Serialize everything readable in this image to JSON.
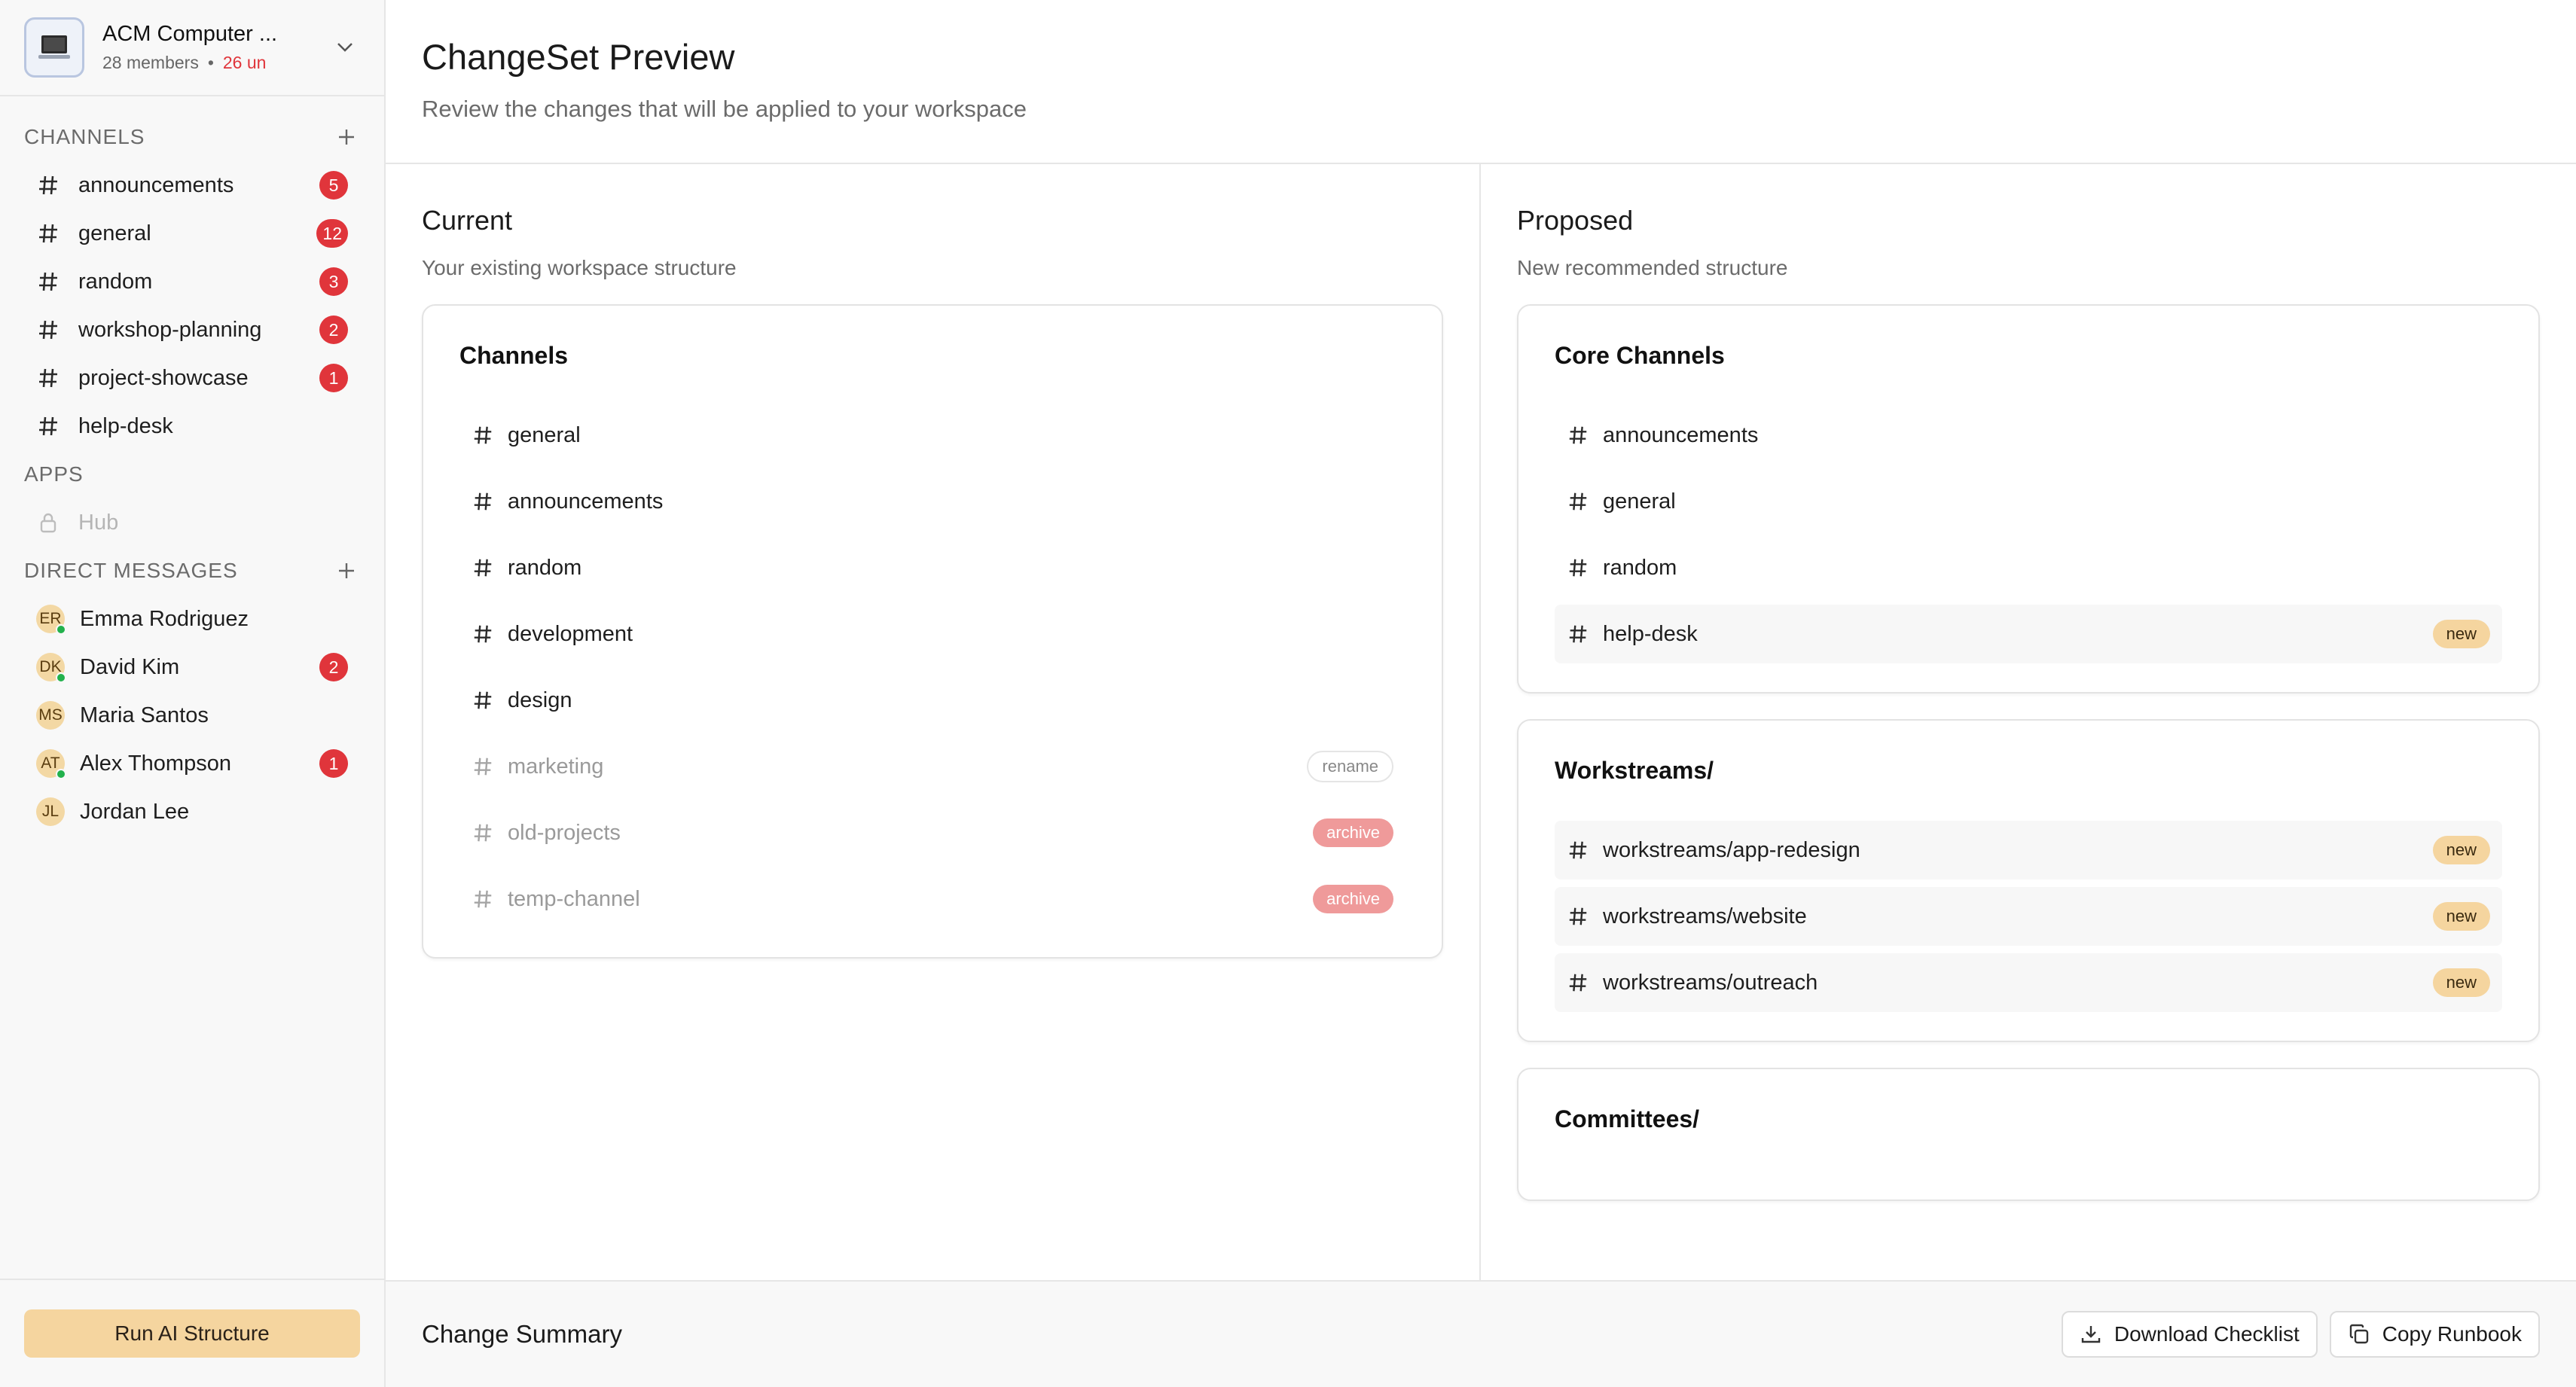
{
  "workspace": {
    "name": "ACM Computer ...",
    "members": "28 members",
    "separator": "•",
    "unread": "26 un"
  },
  "sidebar": {
    "channels_heading": "CHANNELS",
    "channels": [
      {
        "label": "announcements",
        "badge": "5"
      },
      {
        "label": "general",
        "badge": "12"
      },
      {
        "label": "random",
        "badge": "3"
      },
      {
        "label": "workshop-planning",
        "badge": "2"
      },
      {
        "label": "project-showcase",
        "badge": "1"
      },
      {
        "label": "help-desk",
        "badge": ""
      }
    ],
    "apps_heading": "APPS",
    "apps": [
      {
        "label": "Hub",
        "locked": true
      }
    ],
    "dm_heading": "DIRECT MESSAGES",
    "dms": [
      {
        "initials": "ER",
        "name": "Emma Rodriguez",
        "online": true,
        "badge": ""
      },
      {
        "initials": "DK",
        "name": "David Kim",
        "online": true,
        "badge": "2"
      },
      {
        "initials": "MS",
        "name": "Maria Santos",
        "online": false,
        "badge": ""
      },
      {
        "initials": "AT",
        "name": "Alex Thompson",
        "online": true,
        "badge": "1"
      },
      {
        "initials": "JL",
        "name": "Jordan Lee",
        "online": false,
        "badge": ""
      }
    ],
    "run_button": "Run AI Structure"
  },
  "header": {
    "title": "ChangeSet Preview",
    "subtitle": "Review the changes that will be applied to your workspace"
  },
  "current": {
    "title": "Current",
    "subtitle": "Your existing workspace structure",
    "cards": [
      {
        "title": "Channels",
        "items": [
          {
            "label": "general",
            "tag": ""
          },
          {
            "label": "announcements",
            "tag": ""
          },
          {
            "label": "random",
            "tag": ""
          },
          {
            "label": "development",
            "tag": ""
          },
          {
            "label": "design",
            "tag": ""
          },
          {
            "label": "marketing",
            "tag": "rename"
          },
          {
            "label": "old-projects",
            "tag": "archive"
          },
          {
            "label": "temp-channel",
            "tag": "archive"
          }
        ]
      }
    ]
  },
  "proposed": {
    "title": "Proposed",
    "subtitle": "New recommended structure",
    "cards": [
      {
        "title": "Core Channels",
        "items": [
          {
            "label": "announcements",
            "tag": ""
          },
          {
            "label": "general",
            "tag": ""
          },
          {
            "label": "random",
            "tag": ""
          },
          {
            "label": "help-desk",
            "tag": "new"
          }
        ]
      },
      {
        "title": "Workstreams/",
        "items": [
          {
            "label": "workstreams/app-redesign",
            "tag": "new"
          },
          {
            "label": "workstreams/website",
            "tag": "new"
          },
          {
            "label": "workstreams/outreach",
            "tag": "new"
          }
        ]
      },
      {
        "title": "Committees/",
        "items": []
      }
    ]
  },
  "summary": {
    "title": "Change Summary",
    "download_label": "Download Checklist",
    "copy_label": "Copy Runbook"
  },
  "colors": {
    "accent": "#f5d59f",
    "badge": "#e0353b",
    "archive": "#ef9a9a",
    "online": "#22b14c"
  },
  "icons": {
    "channel": "hash-icon",
    "add": "plus-icon",
    "lock": "lock-icon",
    "download": "download-icon",
    "copy": "copy-icon",
    "dropdown": "chevron-down-icon"
  }
}
